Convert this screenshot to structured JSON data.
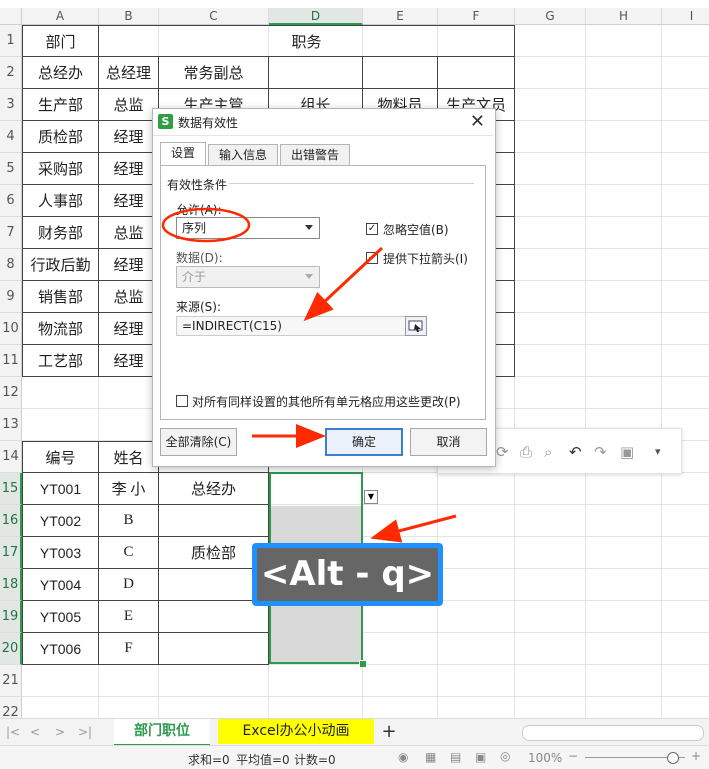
{
  "columns": [
    "A",
    "B",
    "C",
    "D",
    "E",
    "F",
    "G",
    "H",
    "I"
  ],
  "rows": [
    "1",
    "2",
    "3",
    "4",
    "5",
    "6",
    "7",
    "8",
    "9",
    "10",
    "11",
    "12",
    "13",
    "14",
    "15",
    "16",
    "17",
    "18",
    "19",
    "20",
    "21",
    "22"
  ],
  "table1": {
    "header_dept": "部门",
    "header_post": "职务",
    "rows": [
      {
        "dept": "总经办",
        "c1": "总经理",
        "c2": "常务副总",
        "c3": "",
        "c4": "",
        "c5": ""
      },
      {
        "dept": "生产部",
        "c1": "总监",
        "c2": "生产主管",
        "c3": "组长",
        "c4": "物料员",
        "c5": "生产文员"
      },
      {
        "dept": "质检部",
        "c1": "经理",
        "c2": "",
        "c3": "",
        "c4": "",
        "c5": ""
      },
      {
        "dept": "采购部",
        "c1": "经理",
        "c2": "",
        "c3": "",
        "c4": "",
        "c5": ""
      },
      {
        "dept": "人事部",
        "c1": "经理",
        "c2": "",
        "c3": "",
        "c4": "",
        "c5": ""
      },
      {
        "dept": "财务部",
        "c1": "总监",
        "c2": "",
        "c3": "",
        "c4": "",
        "c5": ""
      },
      {
        "dept": "行政后勤",
        "c1": "经理",
        "c2": "",
        "c3": "",
        "c4": "",
        "c5": ""
      },
      {
        "dept": "销售部",
        "c1": "总监",
        "c2": "",
        "c3": "",
        "c4": "",
        "c5": "员"
      },
      {
        "dept": "物流部",
        "c1": "经理",
        "c2": "",
        "c3": "",
        "c4": "",
        "c5": ""
      },
      {
        "dept": "工艺部",
        "c1": "经理",
        "c2": "",
        "c3": "",
        "c4": "",
        "c5": ""
      }
    ]
  },
  "table2": {
    "header_id": "编号",
    "header_name": "姓名",
    "rows": [
      {
        "id": "YT001",
        "name": "李 小",
        "dept": "总经办"
      },
      {
        "id": "YT002",
        "name": "B",
        "dept": ""
      },
      {
        "id": "YT003",
        "name": "C",
        "dept": "质检部"
      },
      {
        "id": "YT004",
        "name": "D",
        "dept": ""
      },
      {
        "id": "YT005",
        "name": "E",
        "dept": ""
      },
      {
        "id": "YT006",
        "name": "F",
        "dept": ""
      }
    ]
  },
  "dialog": {
    "icon": "S",
    "title": "数据有效性",
    "close": "✕",
    "tabs": [
      "设置",
      "输入信息",
      "出错警告"
    ],
    "group_label": "有效性条件",
    "allow_label": "允许(A):",
    "allow_value": "序列",
    "data_label": "数据(D):",
    "data_value": "介于",
    "ignore_blank": "忽略空值(B)",
    "dropdown_arrow": "提供下拉箭头(I)",
    "source_label": "来源(S):",
    "source_value": "=INDIRECT(C15)",
    "apply_all": "对所有同样设置的其他所有单元格应用这些更改(P)",
    "clear_all": "全部清除(C)",
    "ok": "确定",
    "cancel": "取消"
  },
  "shortcut_overlay": "<Alt - q>",
  "sheet_tabs": {
    "active": "部门职位",
    "other": "Excel办公小动画",
    "add": "+"
  },
  "status": {
    "sum": "求和=0",
    "avg": "平均值=0",
    "count": "计数=0",
    "zoom": "100%"
  },
  "colors": {
    "accent_green": "#2e9a4e",
    "highlight_yellow": "#ffff00",
    "arrow_red": "#ff2a00",
    "overlay_blue": "#1e90ff"
  }
}
